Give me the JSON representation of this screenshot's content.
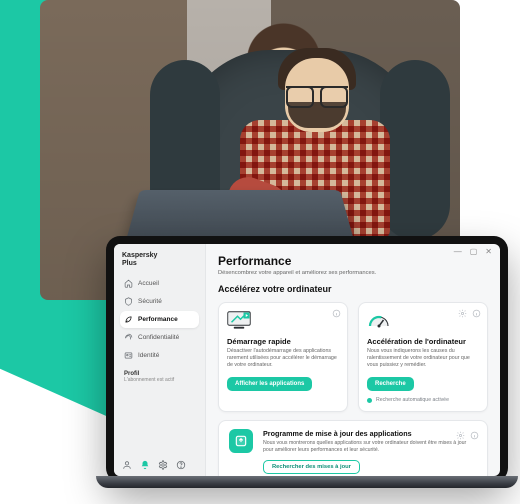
{
  "brand": {
    "line1": "Kaspersky",
    "line2": "Plus"
  },
  "window": {
    "min": "—",
    "max": "▢",
    "close": "✕"
  },
  "sidebar": {
    "items": [
      {
        "label": "Accueil"
      },
      {
        "label": "Sécurité"
      },
      {
        "label": "Performance"
      },
      {
        "label": "Confidentialité"
      },
      {
        "label": "Identité"
      }
    ],
    "profile": {
      "title": "Profil",
      "subtitle": "L'abonnement est actif"
    }
  },
  "page": {
    "title": "Performance",
    "subtitle": "Désencombrez votre appareil et améliorez ses performances.",
    "section": "Accélérez votre ordinateur"
  },
  "cardA": {
    "title": "Démarrage rapide",
    "desc": "Désactiver l'autodémarrage des applications rarement utilisées pour accélérer le démarrage de votre ordinateur.",
    "button": "Afficher les applications"
  },
  "cardB": {
    "title": "Accélération de l'ordinateur",
    "desc": "Nous vous indiquerons les causes du ralentissement de votre ordinateur pour que vous puissiez y remédier.",
    "button": "Recherche",
    "note": "Recherche automatique activée"
  },
  "cardWide": {
    "title": "Programme de mise à jour des applications",
    "desc": "Nous vous montrerons quelles applications sur votre ordinateur doivent être mises à jour pour améliorer leurs performances et leur sécurité.",
    "button": "Rechercher des mises à jour"
  }
}
